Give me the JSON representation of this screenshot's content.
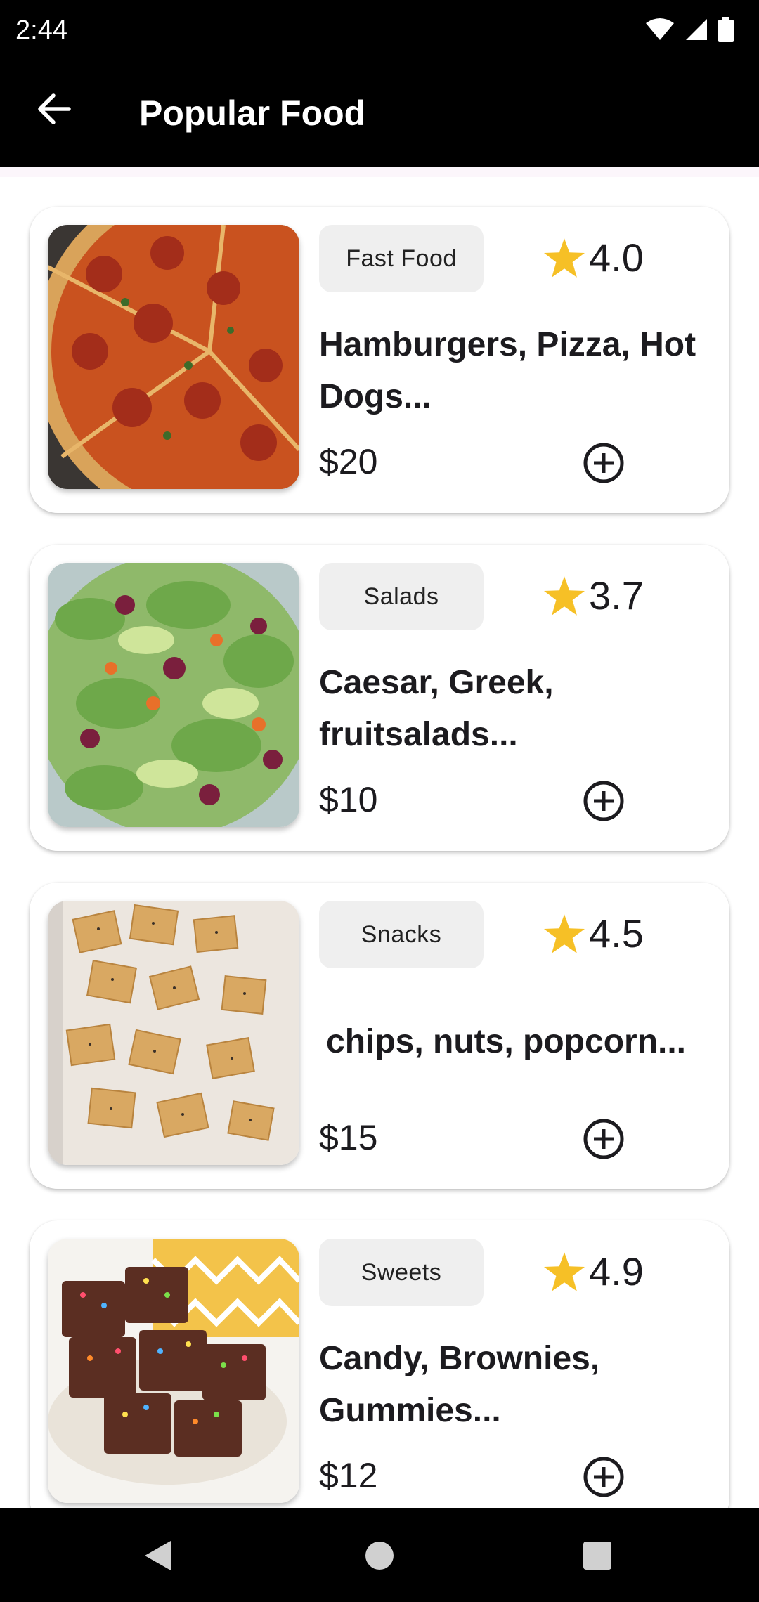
{
  "status_bar": {
    "time": "2:44",
    "icons": [
      "wifi-icon",
      "cellular-signal-icon",
      "battery-icon"
    ]
  },
  "app_bar": {
    "title": "Popular Food",
    "back_icon": "arrow-back-icon"
  },
  "colors": {
    "star": "#f6c026",
    "app_bar": "#000000",
    "chip": "#efefef"
  },
  "items": [
    {
      "category": "Fast Food",
      "rating": "4.0",
      "description": "Hamburgers, Pizza, Hot Dogs...",
      "price": "$20",
      "image": "pizza-image"
    },
    {
      "category": "Salads",
      "rating": "3.7",
      "description": "Caesar, Greek, fruitsalads...",
      "price": "$10",
      "image": "salad-image"
    },
    {
      "category": "Snacks",
      "rating": "4.5",
      "description": "chips, nuts, popcorn...",
      "price": "$15",
      "image": "crackers-image"
    },
    {
      "category": "Sweets",
      "rating": "4.9",
      "description": "Candy, Brownies, Gummies...",
      "price": "$12",
      "image": "brownies-image"
    }
  ],
  "nav_bar": {
    "buttons": [
      "back-triangle-icon",
      "home-circle-icon",
      "recents-square-icon"
    ]
  }
}
